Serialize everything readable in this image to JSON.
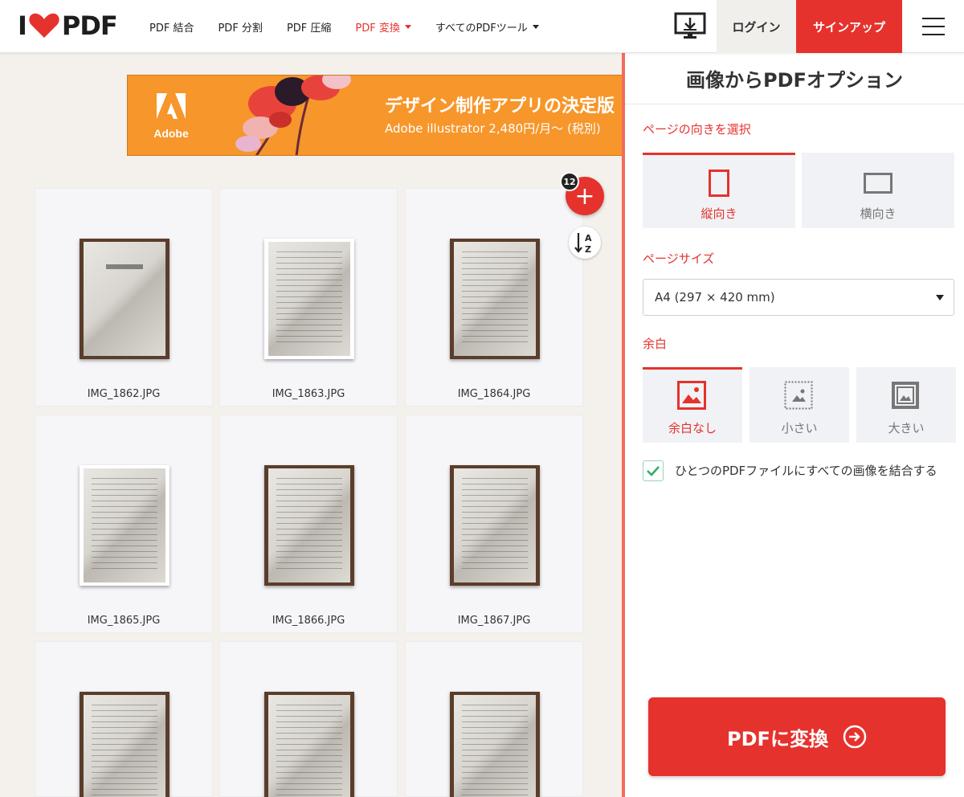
{
  "header": {
    "logo_left": "I",
    "logo_right": "PDF",
    "nav": [
      {
        "label": "PDF 結合",
        "active": false,
        "dropdown": false
      },
      {
        "label": "PDF 分割",
        "active": false,
        "dropdown": false
      },
      {
        "label": "PDF 圧縮",
        "active": false,
        "dropdown": false
      },
      {
        "label": "PDF 変換",
        "active": true,
        "dropdown": true
      },
      {
        "label": "すべてのPDFツール",
        "active": false,
        "dropdown": true
      }
    ],
    "desktop_icon": "desktop-download-icon",
    "login_label": "ログイン",
    "signup_label": "サインアップ",
    "menu_icon": "hamburger-menu-icon"
  },
  "ad": {
    "brand": "Adobe",
    "headline": "デザイン制作アプリの決定版",
    "sub": "Adobe illustrator  2,480円/月～ (税別)"
  },
  "files": [
    {
      "name": "IMG_1862.JPG"
    },
    {
      "name": "IMG_1863.JPG"
    },
    {
      "name": "IMG_1864.JPG"
    },
    {
      "name": "IMG_1865.JPG"
    },
    {
      "name": "IMG_1866.JPG"
    },
    {
      "name": "IMG_1867.JPG"
    },
    {
      "name": ""
    },
    {
      "name": ""
    },
    {
      "name": ""
    }
  ],
  "file_count": "12",
  "add_icon": "plus-icon",
  "sort_label": "A Z",
  "sidebar": {
    "title": "画像からPDFオプション",
    "orientation_label": "ページの向きを選択",
    "orientation_options": [
      "縦向き",
      "横向き"
    ],
    "orientation_selected": "縦向き",
    "page_size_label": "ページサイズ",
    "page_size_value": "A4 (297 × 420 mm)",
    "margin_label": "余白",
    "margin_options": [
      "余白なし",
      "小さい",
      "大きい"
    ],
    "margin_selected": "余白なし",
    "merge_checked": true,
    "merge_label": "ひとつのPDFファイルにすべての画像を結合する",
    "convert_label": "PDFに変換"
  },
  "colors": {
    "brand_red": "#e5322d",
    "ad_orange": "#f7962a",
    "sidebar_accent": "#f26c5b",
    "check_green": "#2fae6b"
  }
}
